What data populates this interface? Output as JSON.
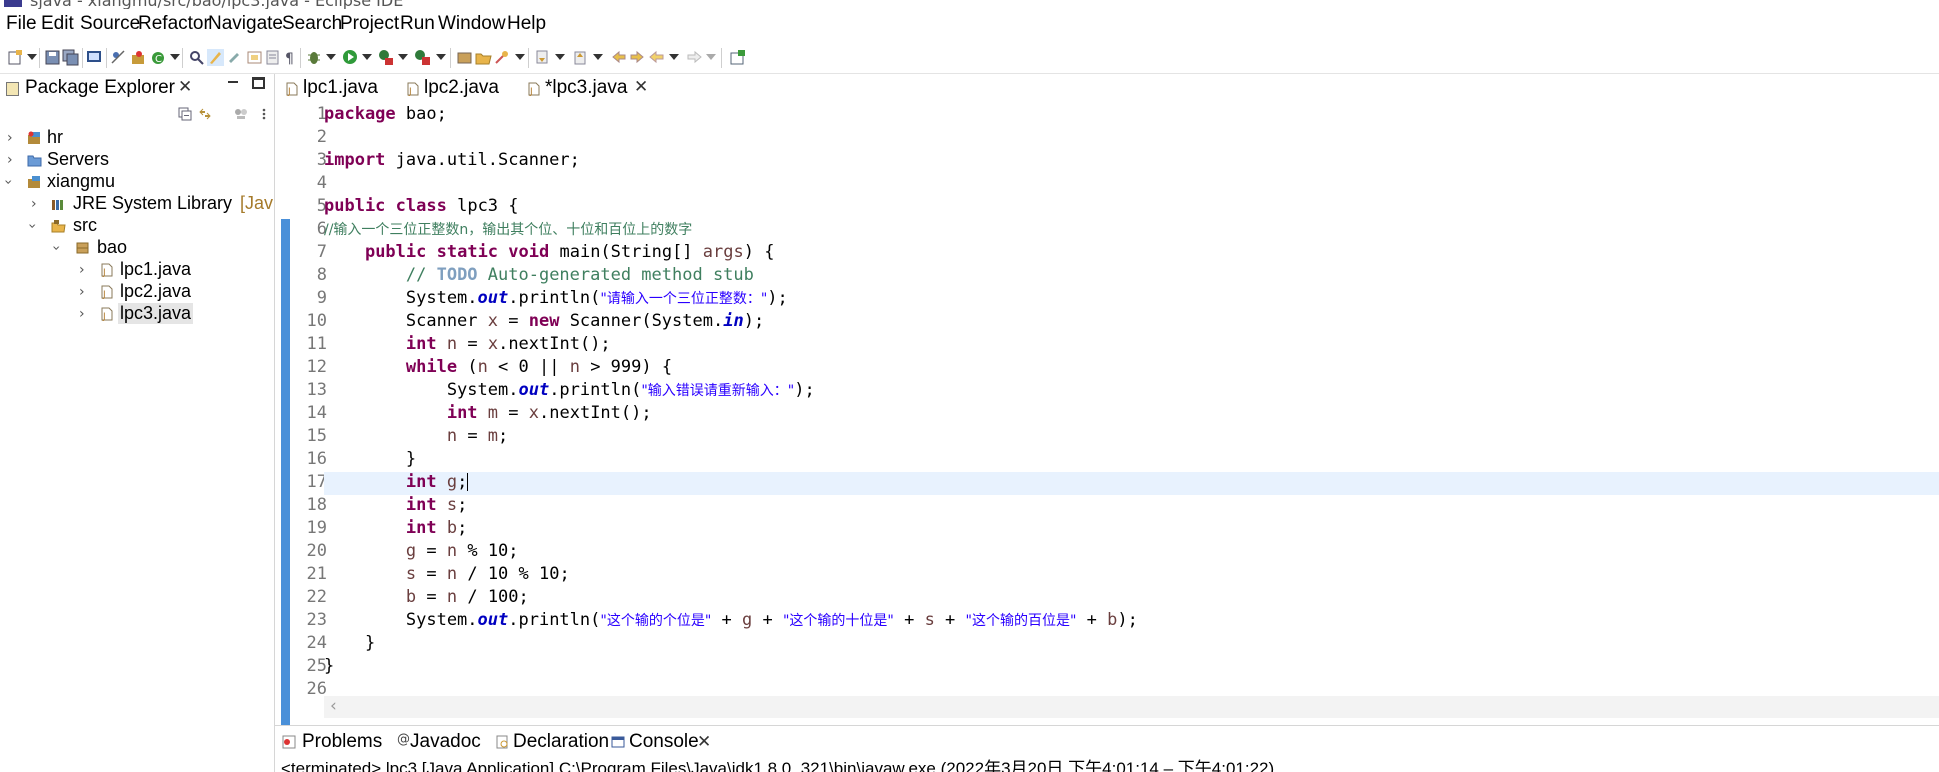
{
  "window": {
    "title": "sjava - xiangmu/src/bao/lpc3.java - Eclipse IDE"
  },
  "menu": [
    "File",
    "Edit",
    "Source",
    "Refactor",
    "Navigate",
    "Search",
    "Project",
    "Run",
    "Window",
    "Help"
  ],
  "package_explorer": {
    "title": "Package Explorer",
    "tree": [
      {
        "label": "hr",
        "icon": "project-icon"
      },
      {
        "label": "Servers",
        "icon": "folder-icon"
      },
      {
        "label": "xiangmu",
        "icon": "project-icon"
      },
      {
        "label": "JRE System Library",
        "suffix": "[Jav",
        "icon": "library-icon"
      },
      {
        "label": "src",
        "icon": "source-folder-icon"
      },
      {
        "label": "bao",
        "icon": "package-icon"
      },
      {
        "label": "lpc1.java",
        "icon": "java-file-icon"
      },
      {
        "label": "lpc2.java",
        "icon": "java-file-icon"
      },
      {
        "label": "lpc3.java",
        "icon": "java-file-icon"
      }
    ]
  },
  "editor_tabs": [
    "lpc1.java",
    "lpc2.java",
    "*lpc3.java"
  ],
  "line_numbers": [
    "1",
    "2",
    "3",
    "4",
    "5",
    "6",
    "7",
    "8",
    "9",
    "10",
    "11",
    "12",
    "13",
    "14",
    "15",
    "16",
    "17",
    "18",
    "19",
    "20",
    "21",
    "22",
    "23",
    "24",
    "25",
    "26"
  ],
  "code": {
    "l1a": "package",
    "l1b": " bao;",
    "l3a": "import",
    "l3b": " java.util.Scanner;",
    "l5a": "public",
    "l5b": " ",
    "l5c": "class",
    "l5d": " lpc3 {",
    "l6": "//输入一个三位正整数n，输出其个位、十位和百位上的数字",
    "l7a": "    ",
    "l7b": "public",
    "l7c": " ",
    "l7d": "static",
    "l7e": " ",
    "l7f": "void",
    "l7g": " main(String[] ",
    "l7h": "args",
    "l7i": ") {",
    "l8a": "        // ",
    "l8b": "TODO",
    "l8c": " Auto-generated method stub",
    "l9a": "        System.",
    "l9b": "out",
    "l9c": ".println(",
    "l9d": "\"请输入一个三位正整数：\"",
    "l9e": ");",
    "l10a": "        Scanner ",
    "l10b": "x",
    "l10c": " = ",
    "l10d": "new",
    "l10e": " Scanner(System.",
    "l10f": "in",
    "l10g": ");",
    "l11a": "        ",
    "l11b": "int",
    "l11c": " ",
    "l11d": "n",
    "l11e": " = ",
    "l11f": "x",
    "l11g": ".nextInt();",
    "l12a": "        ",
    "l12b": "while",
    "l12c": " (",
    "l12d": "n",
    "l12e": " < 0 || ",
    "l12f": "n",
    "l12g": " > 999) {",
    "l13a": "            System.",
    "l13b": "out",
    "l13c": ".println(",
    "l13d": "\"输入错误请重新输入：\"",
    "l13e": ");",
    "l14a": "            ",
    "l14b": "int",
    "l14c": " ",
    "l14d": "m",
    "l14e": " = ",
    "l14f": "x",
    "l14g": ".nextInt();",
    "l15a": "            ",
    "l15b": "n",
    "l15c": " = ",
    "l15d": "m",
    "l15e": ";",
    "l16": "        }",
    "l17a": "        ",
    "l17b": "int",
    "l17c": " ",
    "l17d": "g",
    "l17e": ";",
    "l18a": "        ",
    "l18b": "int",
    "l18c": " ",
    "l18d": "s",
    "l18e": ";",
    "l19a": "        ",
    "l19b": "int",
    "l19c": " ",
    "l19d": "b",
    "l19e": ";",
    "l20a": "        ",
    "l20b": "g",
    "l20c": " = ",
    "l20d": "n",
    "l20e": " % 10;",
    "l21a": "        ",
    "l21b": "s",
    "l21c": " = ",
    "l21d": "n",
    "l21e": " / 10 % 10;",
    "l22a": "        ",
    "l22b": "b",
    "l22c": " = ",
    "l22d": "n",
    "l22e": " / 100;",
    "l23a": "        System.",
    "l23b": "out",
    "l23c": ".println(",
    "l23d": "\"这个输的个位是\"",
    "l23e": " + ",
    "l23f": "g",
    "l23g": " + ",
    "l23h": "\"这个输的十位是\"",
    "l23i": " + ",
    "l23j": "s",
    "l23k": " + ",
    "l23l": "\"这个输的百位是\"",
    "l23m": " + ",
    "l23n": "b",
    "l23o": ");",
    "l24": "    }",
    "l25": "}"
  },
  "bottom_tabs": [
    "Problems",
    "Javadoc",
    "Declaration",
    "Console"
  ],
  "console": {
    "text": "<terminated> lpc3 [Java Application] C:\\Program Files\\Java\\jdk1.8.0_321\\bin\\javaw.exe  (2022年3月20日 下午4:01:14 – 下午4:01:22)"
  },
  "colors": {
    "keyword": "#7f0055",
    "string": "#2a00ff",
    "comment": "#3f7f5f",
    "field": "#0000c0",
    "local_var": "#6a3e3e",
    "current_line": "#e8f2fe",
    "accent": "#3d7bd6"
  }
}
